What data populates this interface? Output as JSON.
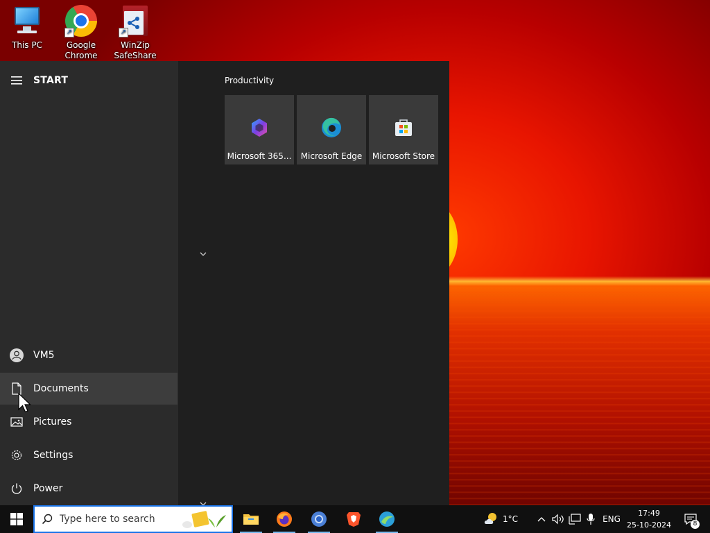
{
  "desktop": {
    "icons": [
      {
        "label_line1": "This PC",
        "label_line2": ""
      },
      {
        "label_line1": "Google",
        "label_line2": "Chrome"
      },
      {
        "label_line1": "WinZip",
        "label_line2": "SafeShare"
      }
    ]
  },
  "start_menu": {
    "title": "START",
    "left_items": [
      {
        "label": "VM5",
        "icon": "user-icon"
      },
      {
        "label": "Documents",
        "icon": "document-icon"
      },
      {
        "label": "Pictures",
        "icon": "pictures-icon"
      },
      {
        "label": "Settings",
        "icon": "gear-icon"
      },
      {
        "label": "Power",
        "icon": "power-icon"
      }
    ],
    "group_title": "Productivity",
    "tiles": [
      {
        "label": "Microsoft 365...",
        "icon": "microsoft-365-icon"
      },
      {
        "label": "Microsoft Edge",
        "icon": "edge-icon"
      },
      {
        "label": "Microsoft Store",
        "icon": "store-icon"
      }
    ]
  },
  "taskbar": {
    "search_placeholder": "Type here to search",
    "apps": [
      "file-explorer-icon",
      "firefox-icon",
      "chrome-icon",
      "brave-icon",
      "app-icon"
    ],
    "weather": "1°C",
    "language": "ENG",
    "time": "17:49",
    "date": "25-10-2024",
    "notifications_count": "8"
  },
  "colors": {
    "accent": "#1a73e8",
    "start_bg": "#1f1f1f",
    "start_left_bg": "#2b2b2b",
    "tile_bg": "#3a3a3a",
    "taskbar_bg": "#101010"
  }
}
